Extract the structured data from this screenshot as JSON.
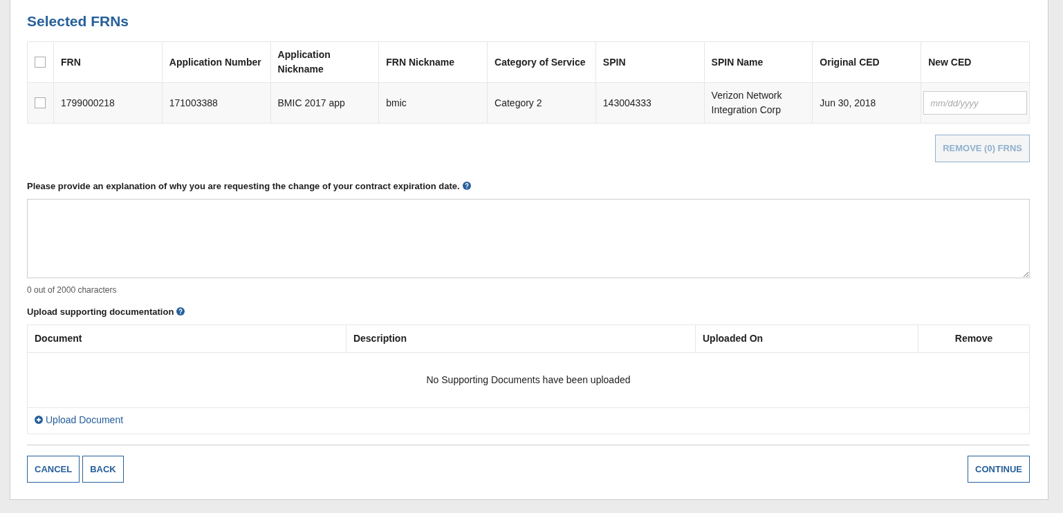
{
  "title": "Selected FRNs",
  "frn_table": {
    "select_all": {
      "checked": false
    },
    "columns": [
      "FRN",
      "Application Number",
      "Application Nickname",
      "FRN Nickname",
      "Category of Service",
      "SPIN",
      "SPIN Name",
      "Original CED",
      "New CED"
    ],
    "rows": [
      {
        "checked": false,
        "cells": [
          "1799000218",
          "171003388",
          "BMIC 2017 app",
          "bmic",
          "Category 2",
          "143004333",
          "Verizon Network Integration Corp",
          "Jun 30, 2018"
        ],
        "new_ced": {
          "placeholder": "mm/dd/yyyy"
        }
      }
    ]
  },
  "remove_button": {
    "label": "REMOVE (0) FRNS",
    "disabled": true
  },
  "explanation": {
    "label": "Please provide an explanation of why you are requesting the change of your contract expiration date.",
    "counter": "0 out of 2000 characters"
  },
  "upload": {
    "label": "Upload supporting documentation",
    "columns": [
      "Document",
      "Description",
      "Uploaded On",
      "Remove"
    ],
    "empty_message": "No Supporting Documents have been uploaded",
    "upload_link": "Upload Document"
  },
  "footer_buttons": {
    "left": [
      "CANCEL",
      "BACK"
    ],
    "right": [
      "CONTINUE"
    ]
  }
}
